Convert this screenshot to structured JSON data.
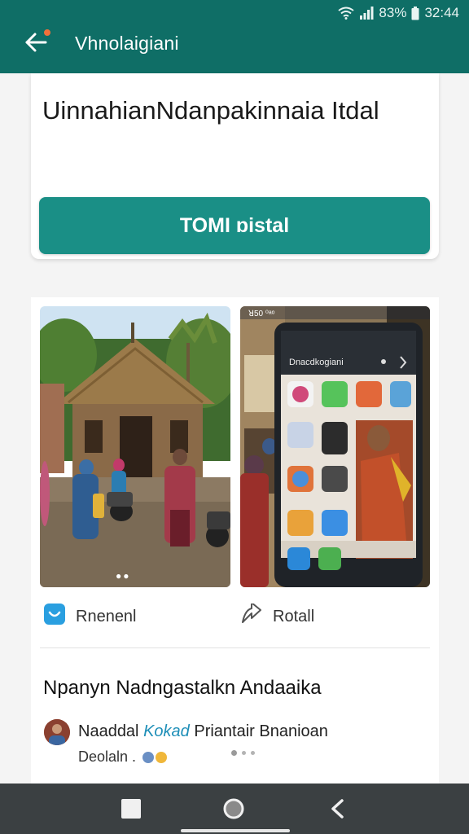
{
  "status_bar": {
    "battery_percent": "83%",
    "time": "32:44"
  },
  "app_bar": {
    "title": "Vhnolaigiani"
  },
  "top_card": {
    "title": "UinnahianNdanpakinnaia Itdal",
    "button_label": "TOMI ɒistal"
  },
  "media": {
    "right_phone_status": "ꓤ50 ⁰ᵃᵒ",
    "right_phone_title": "Dnacdkogiani"
  },
  "actions": {
    "left_label": "Rnenenl",
    "right_label": "Rotall"
  },
  "post": {
    "title": "Npanyn Nadngastalkn Andaaika",
    "author_name": "Naaddal",
    "author_link": "Kokad",
    "author_rest": "Priantair Bnanioan",
    "meta_text": "Deolaln ."
  },
  "colors": {
    "app_bar": "#0f6e66",
    "primary_button": "#1a8f86",
    "link": "#1f8fb8",
    "nav_bar": "#3b4042"
  },
  "icons": {
    "back": "arrow-left-icon",
    "wifi": "wifi-icon",
    "signal": "signal-icon",
    "battery": "battery-icon",
    "left_action": "app-square-icon",
    "right_action": "share-arrow-icon",
    "nav_recent": "square-icon",
    "nav_home": "circle-icon",
    "nav_back": "chevron-left-icon"
  }
}
